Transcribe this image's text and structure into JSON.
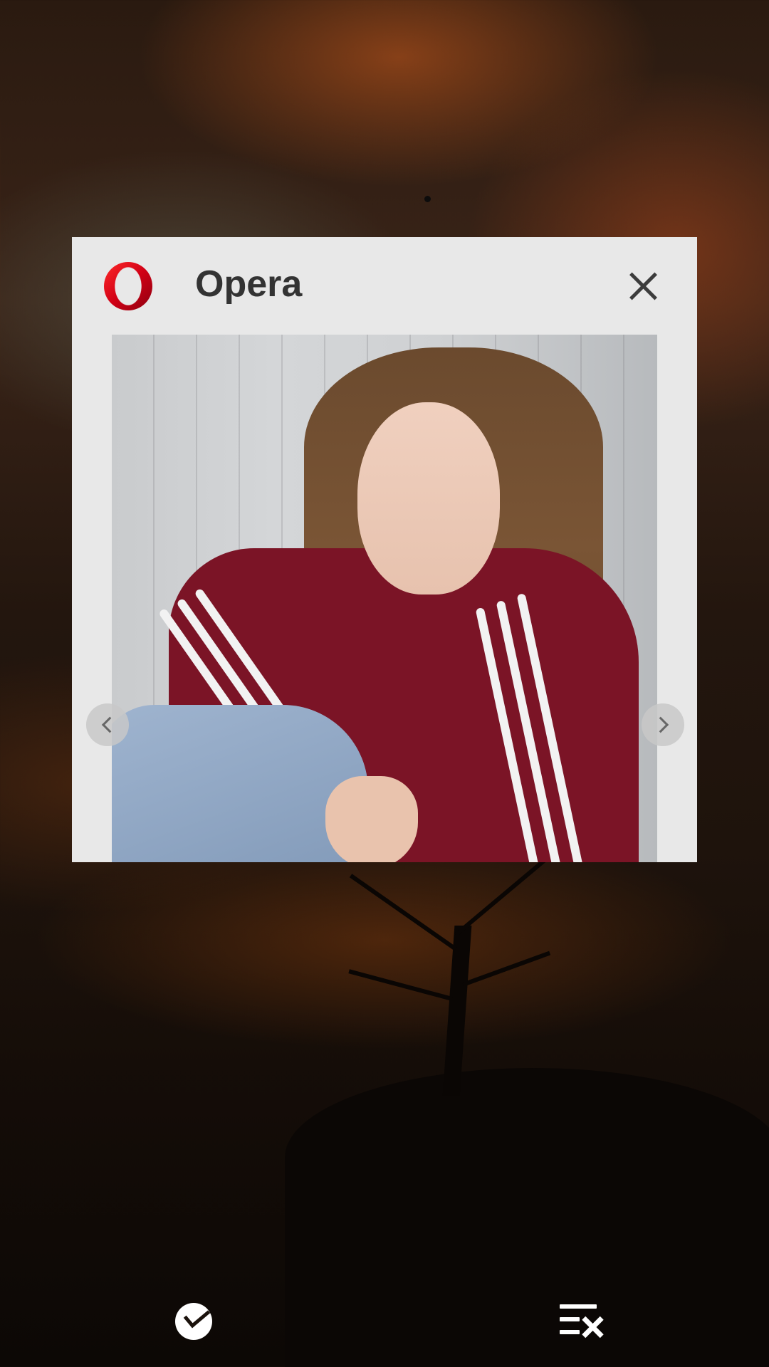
{
  "recents": {
    "page_indicator_icon": "dot-icon",
    "card": {
      "app_name": "Opera",
      "app_icon": "opera-logo-icon",
      "close_icon": "close-icon",
      "preview_description_icon": "image-preview",
      "nav_prev_icon": "chevron-left-icon",
      "nav_next_icon": "chevron-right-icon"
    }
  },
  "bottom_bar": {
    "left_icon": "boost-icon",
    "right_icon": "clear-all-icon"
  },
  "colors": {
    "card_background": "#e8e8e8",
    "title_text": "#333333",
    "opera_red": "#d10015",
    "jacket_red": "#7b1426"
  }
}
